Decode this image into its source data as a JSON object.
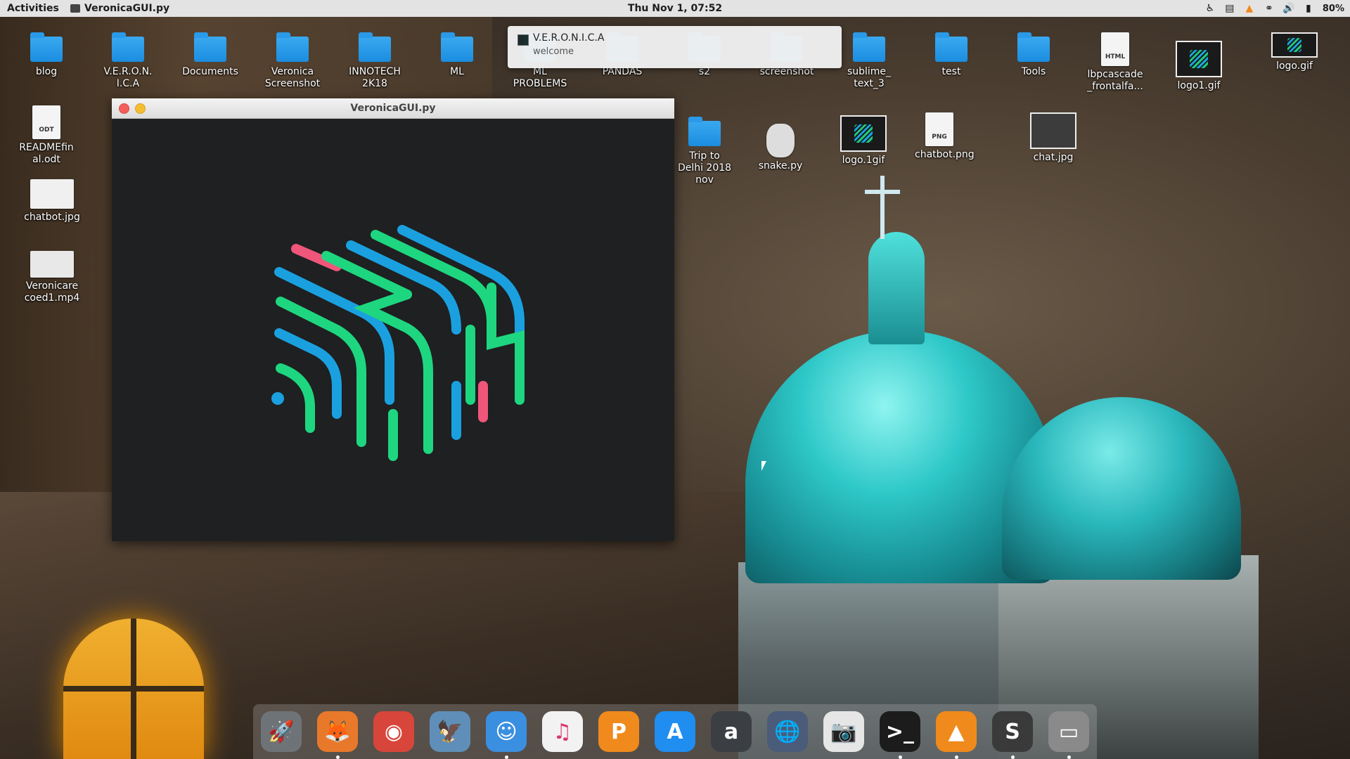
{
  "topbar": {
    "activities": "Activities",
    "app_name": "VeronicaGUI.py",
    "clock": "Thu Nov  1, 07:52",
    "battery": "80%"
  },
  "notification": {
    "title": "V.E.R.O.N.I.C.A",
    "body": "welcome"
  },
  "window": {
    "title": "VeronicaGUI.py"
  },
  "desktop_icons": [
    {
      "label": "blog",
      "type": "folder"
    },
    {
      "label": "V.E.R.O.N.I.C.A",
      "type": "folder"
    },
    {
      "label": "Documents",
      "type": "folder"
    },
    {
      "label": "Veronica Screenshot",
      "type": "folder"
    },
    {
      "label": "INNOTECH 2K18",
      "type": "folder"
    },
    {
      "label": "ML",
      "type": "folder"
    },
    {
      "label": "ML PROBLEMS",
      "type": "folder"
    },
    {
      "label": "PANDAS",
      "type": "folder"
    },
    {
      "label": "s2",
      "type": "folder"
    },
    {
      "label": "screenshot",
      "type": "folder"
    },
    {
      "label": "sublime_text_3",
      "type": "folder"
    },
    {
      "label": "test",
      "type": "folder"
    },
    {
      "label": "Tools",
      "type": "folder"
    },
    {
      "label": "lbpcascade_frontalfa...",
      "type": "html"
    },
    {
      "label": "logo1.gif",
      "type": "image"
    },
    {
      "label": "logo.gif",
      "type": "image"
    },
    {
      "label": "READMEfinal.odt",
      "type": "doc"
    },
    {
      "label": "chatbot.jpg",
      "type": "image"
    },
    {
      "label": "Veronicarecoed1.mp4",
      "type": "video"
    },
    {
      "label": "Trip to Delhi 2018 nov",
      "type": "folder"
    },
    {
      "label": "snake.py",
      "type": "script"
    },
    {
      "label": "logo.1gif",
      "type": "image"
    },
    {
      "label": "chatbot.png",
      "type": "image"
    },
    {
      "label": "chat.jpg",
      "type": "image"
    }
  ],
  "dock": [
    {
      "name": "launchpad-icon",
      "glyph": "🚀",
      "color": "#6e7378",
      "running": false
    },
    {
      "name": "firefox-icon",
      "glyph": "🦊",
      "color": "#e8792b",
      "running": true
    },
    {
      "name": "chrome-icon",
      "glyph": "◉",
      "color": "#d8453a",
      "running": false
    },
    {
      "name": "eagle-icon",
      "glyph": "🦅",
      "color": "#5f8fb8",
      "running": false
    },
    {
      "name": "finder-icon",
      "glyph": "☺",
      "color": "#3b8fe0",
      "running": true
    },
    {
      "name": "music-icon",
      "glyph": "♫",
      "color": "#f2f2f2",
      "running": false
    },
    {
      "name": "presentation-icon",
      "glyph": "P",
      "color": "#f08a1c",
      "running": false
    },
    {
      "name": "appstore-icon",
      "glyph": "A",
      "color": "#1f8ef0",
      "running": false
    },
    {
      "name": "amazon-icon",
      "glyph": "a",
      "color": "#3b3f44",
      "running": false
    },
    {
      "name": "network-icon",
      "glyph": "🌐",
      "color": "#4a5c7a",
      "running": false
    },
    {
      "name": "screenshot-icon",
      "glyph": "📷",
      "color": "#e6e6e6",
      "running": false
    },
    {
      "name": "terminal-icon",
      "glyph": ">_",
      "color": "#1c1c1c",
      "running": true
    },
    {
      "name": "vlc-icon",
      "glyph": "▲",
      "color": "#f08a1c",
      "running": true
    },
    {
      "name": "sublime-icon",
      "glyph": "S",
      "color": "#3a3a3a",
      "running": true
    },
    {
      "name": "window-icon",
      "glyph": "▭",
      "color": "#8a8a8a",
      "running": true
    }
  ],
  "colors": {
    "logo_green": "#1ed67f",
    "logo_blue": "#1ba0df",
    "logo_pink": "#f0567a",
    "window_bg": "#1e2021"
  }
}
